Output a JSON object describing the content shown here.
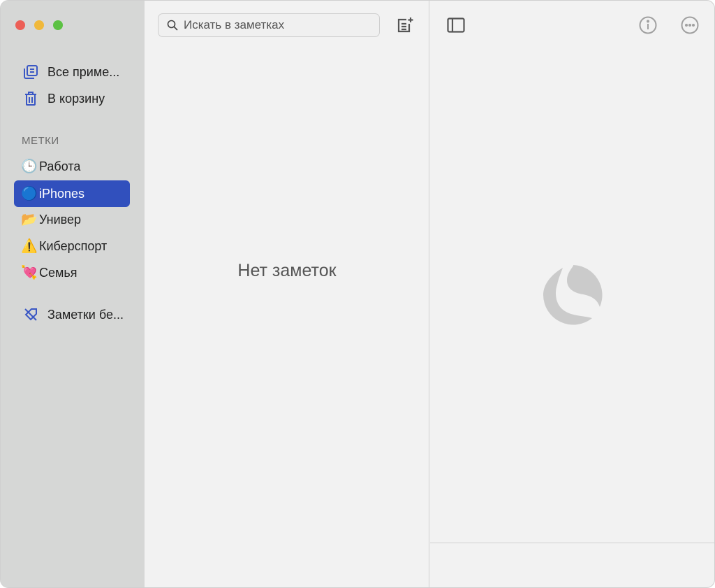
{
  "sidebar": {
    "items": [
      {
        "label": "Все приме...",
        "icon": "all-notes-icon"
      },
      {
        "label": "В корзину",
        "icon": "trash-icon"
      }
    ],
    "section_title": "МЕТКИ",
    "tags": [
      {
        "emoji": "🕒",
        "label": "Работа"
      },
      {
        "emoji": "🔵",
        "label": "iPhones"
      },
      {
        "emoji": "📂",
        "label": "Универ"
      },
      {
        "emoji": "⚠️",
        "label": "Киберспорт"
      },
      {
        "emoji": "💘",
        "label": "Семья"
      }
    ],
    "untagged": "Заметки бе..."
  },
  "list": {
    "search_placeholder": "Искать в заметках",
    "empty_text": "Нет заметок"
  },
  "colors": {
    "accent": "#3150bd",
    "icons": "#3a57c4"
  }
}
